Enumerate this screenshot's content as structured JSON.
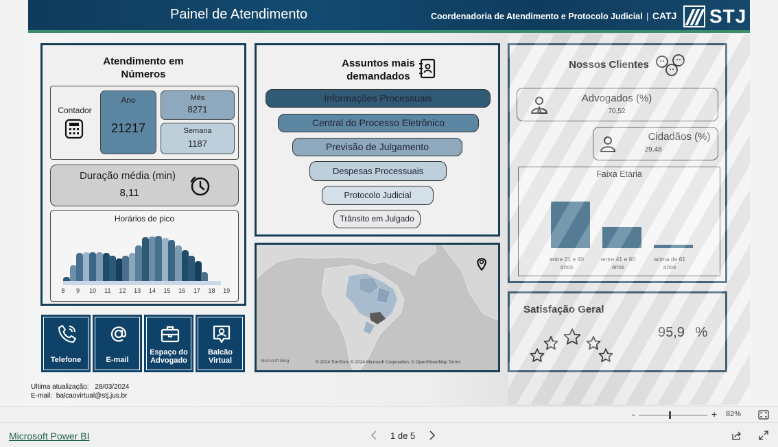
{
  "header": {
    "title": "Painel de Atendimento",
    "org": "Coordenadoria de Atendimento e Protocolo Judicial",
    "separator": "|",
    "org_short": "CATJ",
    "logo_text": "STJ"
  },
  "numbers": {
    "title_line1": "Atendimento em",
    "title_line2": "Números",
    "contador_label": "Contador",
    "ano_label": "Ano",
    "ano_value": "21217",
    "mes_label": "Mês",
    "mes_value": "8271",
    "semana_label": "Semana",
    "semana_value": "1187",
    "duracao_label": "Duração média (min)",
    "duracao_value": "8,11",
    "pico_title": "Horários de pico",
    "pico_hours": [
      "8",
      "9",
      "10",
      "11",
      "12",
      "13",
      "14",
      "15",
      "16",
      "17",
      "18",
      "19"
    ]
  },
  "chart_data": [
    {
      "type": "area",
      "title": "Horários de pico",
      "x": [
        "8",
        "9",
        "10",
        "11",
        "12",
        "13",
        "14",
        "15",
        "16",
        "17",
        "18",
        "19"
      ],
      "values": [
        0.15,
        0.6,
        0.62,
        0.6,
        0.5,
        0.6,
        0.9,
        0.92,
        0.85,
        0.65,
        0.45,
        0.05
      ],
      "ylabel": "",
      "grid": false
    },
    {
      "type": "bar",
      "title": "Faixa Etária",
      "categories": [
        "entre 21 e 40 anos",
        "entre 41 e 60 anos",
        "acima de 61 anos"
      ],
      "values": [
        100,
        45,
        8
      ],
      "ylim": [
        0,
        100
      ]
    }
  ],
  "assuntos": {
    "title_line1": "Assuntos mais",
    "title_line2": "demandados",
    "items": [
      {
        "label": "Informações Processuais",
        "color": "#315a74"
      },
      {
        "label": "Central do Processo Eletrônico",
        "color": "#5d86a3"
      },
      {
        "label": "Previsão de Julgamento",
        "color": "#8ea9bd"
      },
      {
        "label": "Despesas Processuais",
        "color": "#bccfdb"
      },
      {
        "label": "Protocolo Judicial",
        "color": "#d4e0e8"
      },
      {
        "label": "Trânsito em Julgado",
        "color": "#eaeaea"
      }
    ]
  },
  "map": {
    "attribution": "© 2024 TomTom, © 2024 Microsoft Corporation, © OpenStreetMap  Terms",
    "bing": "Microsoft Bing"
  },
  "clientes": {
    "title": "Nossos Clientes",
    "advogados_label": "Advogados (%)",
    "advogados_value": "70,52",
    "cidadaos_label": "Cidadãos (%)",
    "cidadaos_value": "29,48",
    "faixa_title": "Faixa Etária",
    "faixa_cats": [
      {
        "l1": "entre 21 e 40",
        "l2": "anos"
      },
      {
        "l1": "entre 41 e 60",
        "l2": "anos"
      },
      {
        "l1": "acima de 61",
        "l2": "anos"
      }
    ]
  },
  "satisfacao": {
    "title": "Satisfação Geral",
    "value": "95,9",
    "unit": "%"
  },
  "tiles": [
    {
      "l1": "Telefone",
      "l2": ""
    },
    {
      "l1": "E-mail",
      "l2": ""
    },
    {
      "l1": "Espaço do",
      "l2": "Advogado"
    },
    {
      "l1": "Balcão",
      "l2": "Virtual"
    }
  ],
  "footer": {
    "update_label": "Ultima atualização:",
    "update_value": "28/03/2024",
    "email_label": "E-mail:",
    "email_value": "balcaovirtual@stj.jus.br"
  },
  "viewer": {
    "zoom_minus": "-",
    "zoom_plus": "+",
    "zoom": "82%",
    "zoom_level": 0.45,
    "brand": "Microsoft Power BI",
    "page": "1 de 5"
  },
  "colors": {
    "navy": "#0f4268",
    "accent_green": "#3b8e6a",
    "bar": "#2e6282"
  }
}
